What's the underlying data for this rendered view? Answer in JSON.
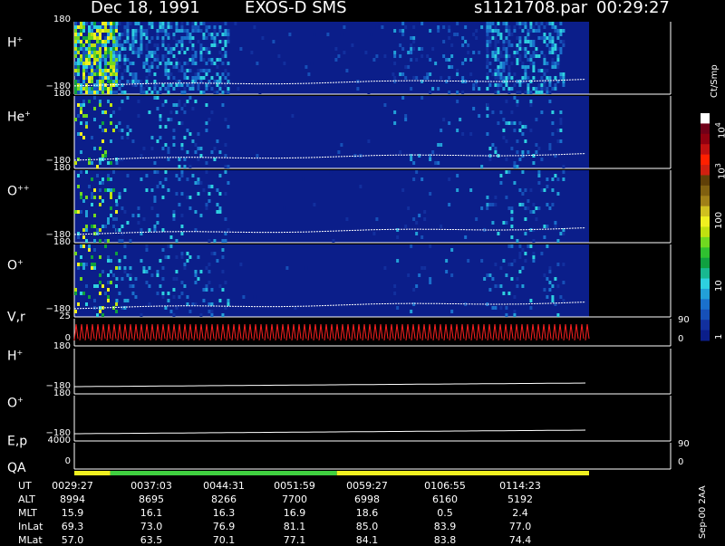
{
  "title": {
    "date": "Dec 18, 1991",
    "instrument": "EXOS-D SMS",
    "file": "s1121708.par",
    "time": "00:29:27"
  },
  "panels": [
    {
      "id": "h_plus",
      "label": "H",
      "sup": "+",
      "top_tick": "180",
      "bottom_tick": "−180"
    },
    {
      "id": "he_plus",
      "label": "He",
      "sup": "+",
      "top_tick": "180",
      "bottom_tick": "−180"
    },
    {
      "id": "o_pp",
      "label": "O",
      "sup": "++",
      "top_tick": "180",
      "bottom_tick": "−180"
    },
    {
      "id": "o_plus",
      "label": "O",
      "sup": "+",
      "top_tick": "180",
      "bottom_tick": "−180"
    },
    {
      "id": "vr",
      "label": "V,r",
      "sup": "",
      "top_tick": "25",
      "bottom_tick": "0",
      "right_top": "90",
      "right_bottom": "0"
    },
    {
      "id": "h_plus_2",
      "label": "H",
      "sup": "+",
      "top_tick": "180",
      "bottom_tick": "−180"
    },
    {
      "id": "o_plus_2",
      "label": "O",
      "sup": "+",
      "top_tick": "180",
      "bottom_tick": "−180"
    },
    {
      "id": "ep",
      "label": "E,p",
      "sup": "",
      "top_tick": "4000",
      "bottom_tick": "0",
      "right_top": "90",
      "right_bottom": "0"
    }
  ],
  "qa_label": "QA",
  "colorbar": {
    "unit": "Ct/Smp",
    "ticks": [
      {
        "label": "1",
        "base": "",
        "exp": ""
      },
      {
        "label": "10",
        "base": "",
        "exp": ""
      },
      {
        "label": "100",
        "base": "",
        "exp": ""
      },
      {
        "label": "",
        "base": "10",
        "exp": "3"
      },
      {
        "label": "",
        "base": "10",
        "exp": "4"
      }
    ],
    "colors": [
      "#0b1e8a",
      "#12309e",
      "#1650b8",
      "#1a70cc",
      "#22a0d8",
      "#2ed0e0",
      "#18b890",
      "#10a040",
      "#30c030",
      "#70d820",
      "#c0e010",
      "#f0f020",
      "#d0c020",
      "#a08018",
      "#806010",
      "#604008",
      "#d02010",
      "#ff2000",
      "#c01010",
      "#900010",
      "#700018",
      "#ffffff"
    ]
  },
  "chart_data": {
    "type": "heatmap",
    "time_ticks": [
      "0029:27",
      "0037:03",
      "0044:31",
      "0051:59",
      "0059:27",
      "0106:55",
      "0114:23"
    ],
    "spectrogram_columns": [
      {
        "start": 0,
        "end": 0.08,
        "level": "high"
      },
      {
        "start": 0.08,
        "end": 0.3,
        "level": "medium"
      },
      {
        "start": 0.3,
        "end": 0.62,
        "level": "low"
      },
      {
        "start": 0.62,
        "end": 0.8,
        "level": "medium-low"
      },
      {
        "start": 0.8,
        "end": 0.95,
        "level": "medium"
      }
    ],
    "qa_bar": [
      {
        "start": 0,
        "end": 0.07,
        "color": "#f0f020"
      },
      {
        "start": 0.07,
        "end": 0.51,
        "color": "#40d040"
      },
      {
        "start": 0.51,
        "end": 1.0,
        "color": "#f0f020"
      }
    ],
    "ephemeris": {
      "rows": [
        {
          "name": "UT",
          "values": [
            "0029:27",
            "0037:03",
            "0044:31",
            "0051:59",
            "0059:27",
            "0106:55",
            "0114:23"
          ]
        },
        {
          "name": "ALT",
          "values": [
            "8994",
            "8695",
            "8266",
            "7700",
            "6998",
            "6160",
            "5192"
          ]
        },
        {
          "name": "MLT",
          "values": [
            "15.9",
            "16.1",
            "16.3",
            "16.9",
            "18.6",
            "0.5",
            "2.4"
          ]
        },
        {
          "name": "InLat",
          "values": [
            "69.3",
            "73.0",
            "76.9",
            "81.1",
            "85.0",
            "83.9",
            "77.0"
          ]
        },
        {
          "name": "MLat",
          "values": [
            "57.0",
            "63.5",
            "70.1",
            "77.1",
            "84.1",
            "83.8",
            "74.4"
          ]
        }
      ]
    }
  },
  "footer_tag": "Sep-00 2AA",
  "colors": {
    "background": "#0b1e8a",
    "line_red": "#ff2020",
    "qa_green": "#40d040",
    "qa_yellow": "#f0f020"
  }
}
